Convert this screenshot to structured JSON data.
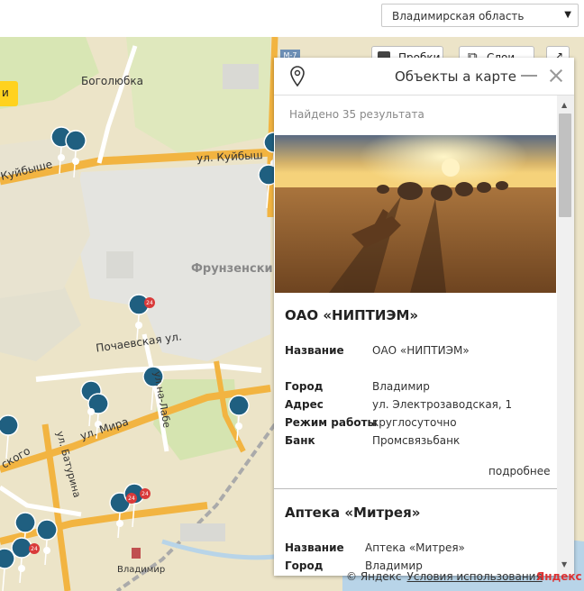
{
  "header": {
    "region_select": "Владимирская область"
  },
  "map": {
    "controls": {
      "traffic_label": "Пробки",
      "layers_label": "Слои",
      "yellow_button_label": "и"
    },
    "labels": {
      "bogolyubka": "Боголюбка",
      "kuybysheva_right": "ул. Куйбыш",
      "kuybysheva_left": "Куйбыше",
      "frunzensky": "Фрунзенски",
      "pochaevskaya": "Почаевская ул.",
      "na_labe": "ул.на-Лабе",
      "mira": "ул. Мира",
      "baturina": "ул. Батурина",
      "kogo": "ского",
      "vladimir": "Владимир",
      "road_code": "M-7"
    },
    "badge_label": "24",
    "copyright": "© Яндекс",
    "terms_link": "Условия использования",
    "logo": "Яндекс"
  },
  "panel": {
    "title": "Объекты а карте",
    "found_text": "Найдено 35 результата",
    "more_link": "подробнее",
    "objects": [
      {
        "title": "ОАО «НИПТИЭМ»",
        "fields": [
          {
            "label": "Название",
            "value": "ОАО «НИПТИЭМ»"
          },
          {
            "label": "Город",
            "value": "Владимир"
          },
          {
            "label": "Адрес",
            "value": "ул. Электрозаводская, 1"
          },
          {
            "label": "Режим работы",
            "value": "круглосуточно"
          },
          {
            "label": "Банк",
            "value": "Промсвязьбанк"
          }
        ]
      },
      {
        "title": "Аптека «Митрея»",
        "fields": [
          {
            "label": "Название",
            "value": "Аптека «Митрея»"
          },
          {
            "label": "Город",
            "value": "Владимир"
          }
        ]
      }
    ]
  },
  "colors": {
    "map_background": "#ece4c8",
    "road_orange": "#f2b441",
    "marker_blue": "#1f5f80",
    "badge_red": "#d93a3a",
    "control_yellow": "#ffd21e"
  }
}
